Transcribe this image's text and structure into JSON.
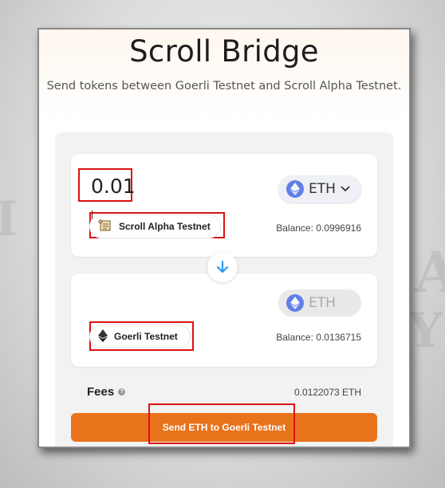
{
  "header": {
    "title": "Scroll Bridge",
    "subtitle": "Send tokens between Goerli Testnet and Scroll Alpha Testnet."
  },
  "from": {
    "amount": "0.01",
    "token": "ETH",
    "chain": "Scroll Alpha Testnet",
    "balance": "Balance: 0.0996916"
  },
  "to": {
    "token": "ETH",
    "chain": "Goerli Testnet",
    "balance": "Balance: 0.0136715"
  },
  "fees": {
    "label": "Fees",
    "value": "0.0122073 ETH"
  },
  "send_button": "Send ETH to Goerli Testnet",
  "colors": {
    "accent": "#e8731b",
    "highlight_box": "#dd1111",
    "eth_icon": "#627eea"
  },
  "icons": {
    "scroll_chain": "scroll-parchment-icon",
    "goerli_chain": "ethereum-icon",
    "swap_direction": "arrow-down-icon",
    "fees_info": "info-icon",
    "token_dropdown": "chevron-down-icon"
  }
}
